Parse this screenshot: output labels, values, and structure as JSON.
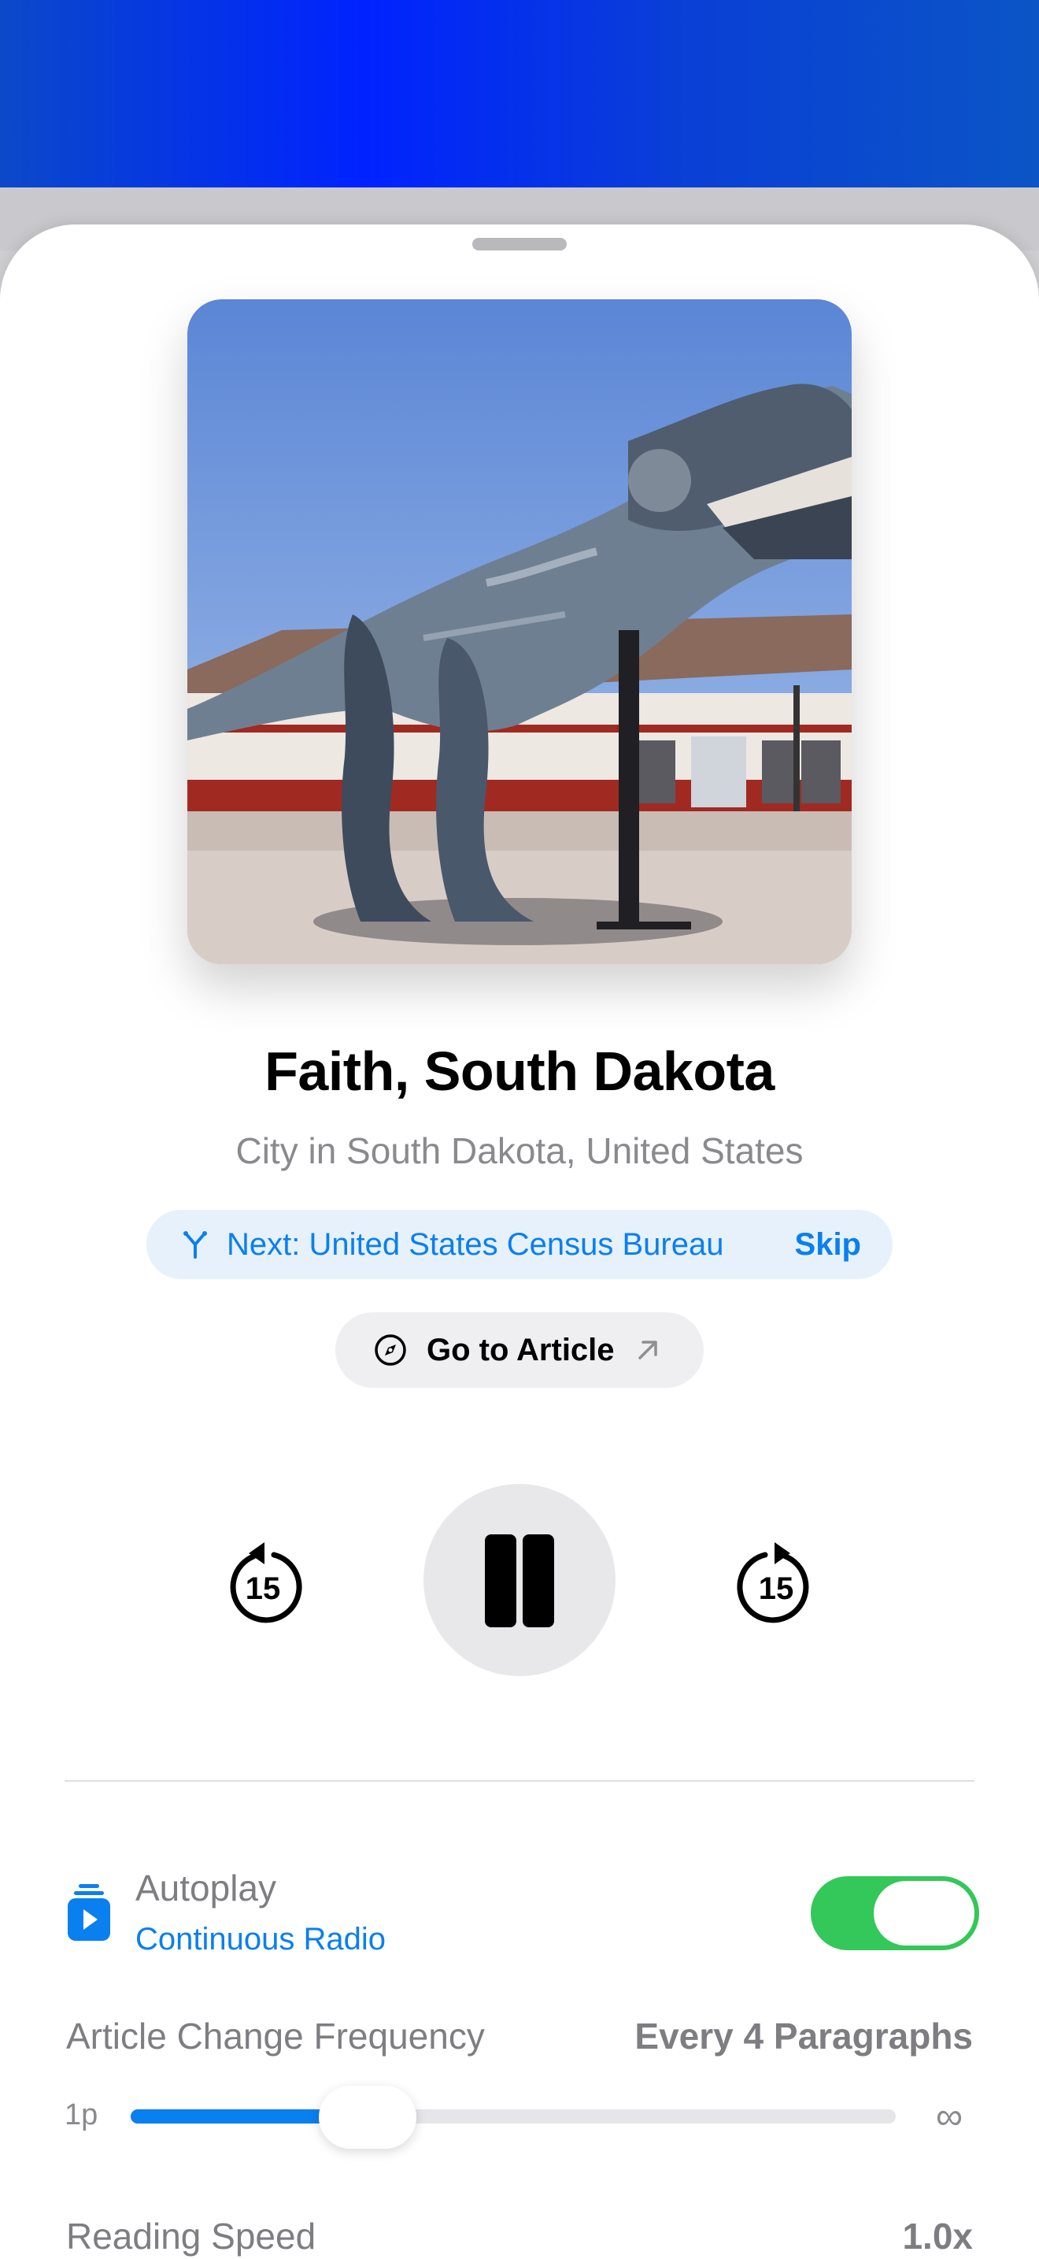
{
  "now_playing": {
    "title": "Faith, South Dakota",
    "subtitle": "City in South Dakota, United States",
    "artwork_description_icon": "t-rex-sculpture-photo"
  },
  "next_up": {
    "label": "Next: United States Census Bureau",
    "skip_label": "Skip",
    "icon": "branch-icon"
  },
  "go_to_article": {
    "label": "Go to Article",
    "leading_icon": "compass-icon",
    "trailing_icon": "arrow-up-right-icon"
  },
  "controls": {
    "skip_back_seconds": "15",
    "skip_forward_seconds": "15",
    "state": "playing"
  },
  "autoplay": {
    "label": "Autoplay",
    "mode": "Continuous Radio",
    "enabled": true
  },
  "article_change_frequency": {
    "label": "Article Change Frequency",
    "value": "Every 4 Paragraphs",
    "slider_min_label": "1p",
    "slider_max_label": "∞",
    "slider_fraction": 0.31
  },
  "reading_speed": {
    "label": "Reading Speed",
    "value": "1.0x"
  },
  "colors": {
    "accent": "#0a7ff0",
    "toggle_on": "#34c759",
    "header_band": "#0022ff"
  }
}
